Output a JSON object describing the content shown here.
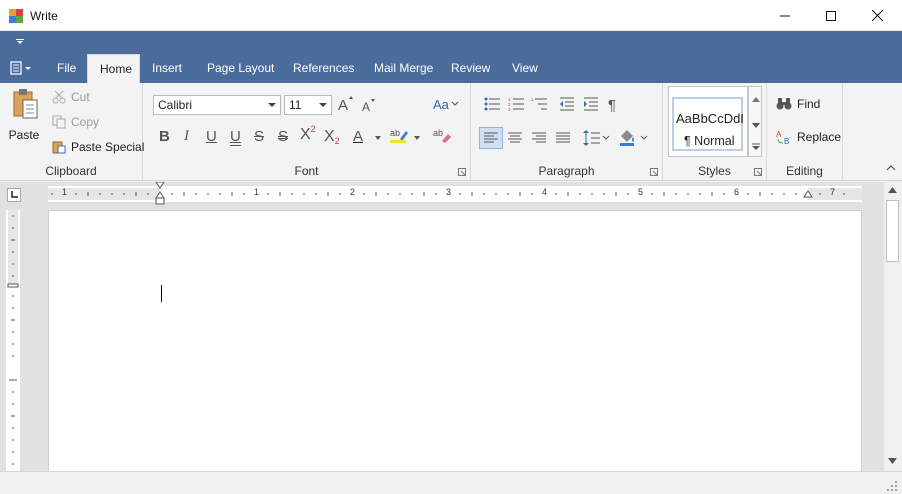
{
  "window": {
    "title": "Write",
    "controls": [
      "minimize-icon",
      "maximize-icon",
      "close-icon"
    ]
  },
  "tabs": {
    "items": [
      {
        "label": "File"
      },
      {
        "label": "Home"
      },
      {
        "label": "Insert"
      },
      {
        "label": "Page Layout"
      },
      {
        "label": "References"
      },
      {
        "label": "Mail Merge"
      },
      {
        "label": "Review"
      },
      {
        "label": "View"
      }
    ],
    "active": "Home"
  },
  "ribbon": {
    "clipboard": {
      "label": "Clipboard",
      "paste": "Paste",
      "cut": "Cut",
      "copy": "Copy",
      "paste_special": "Paste Special"
    },
    "font": {
      "label": "Font",
      "family": "Calibri",
      "size": "11",
      "bold": "B",
      "italic": "I",
      "underline": "U",
      "double_underline": "U",
      "strikethrough": "S",
      "double_strikethrough": "S",
      "superscript": "X",
      "subscript": "X",
      "font_color": "A"
    },
    "paragraph": {
      "label": "Paragraph"
    },
    "styles": {
      "label": "Styles",
      "sample": "AaBbCcDdI",
      "name": "¶ Normal"
    },
    "editing": {
      "label": "Editing",
      "find": "Find",
      "replace": "Replace"
    }
  },
  "ruler": {
    "numbers": [
      "1",
      "1",
      "2",
      "3",
      "4",
      "5",
      "6",
      "7"
    ]
  },
  "colors": {
    "title_bar": "#ffffff",
    "tab_strip": "#4a6c9b",
    "ribbon": "#f3f3f3",
    "workspace": "#e1e1e1",
    "accent_blue": "#2b579a"
  }
}
